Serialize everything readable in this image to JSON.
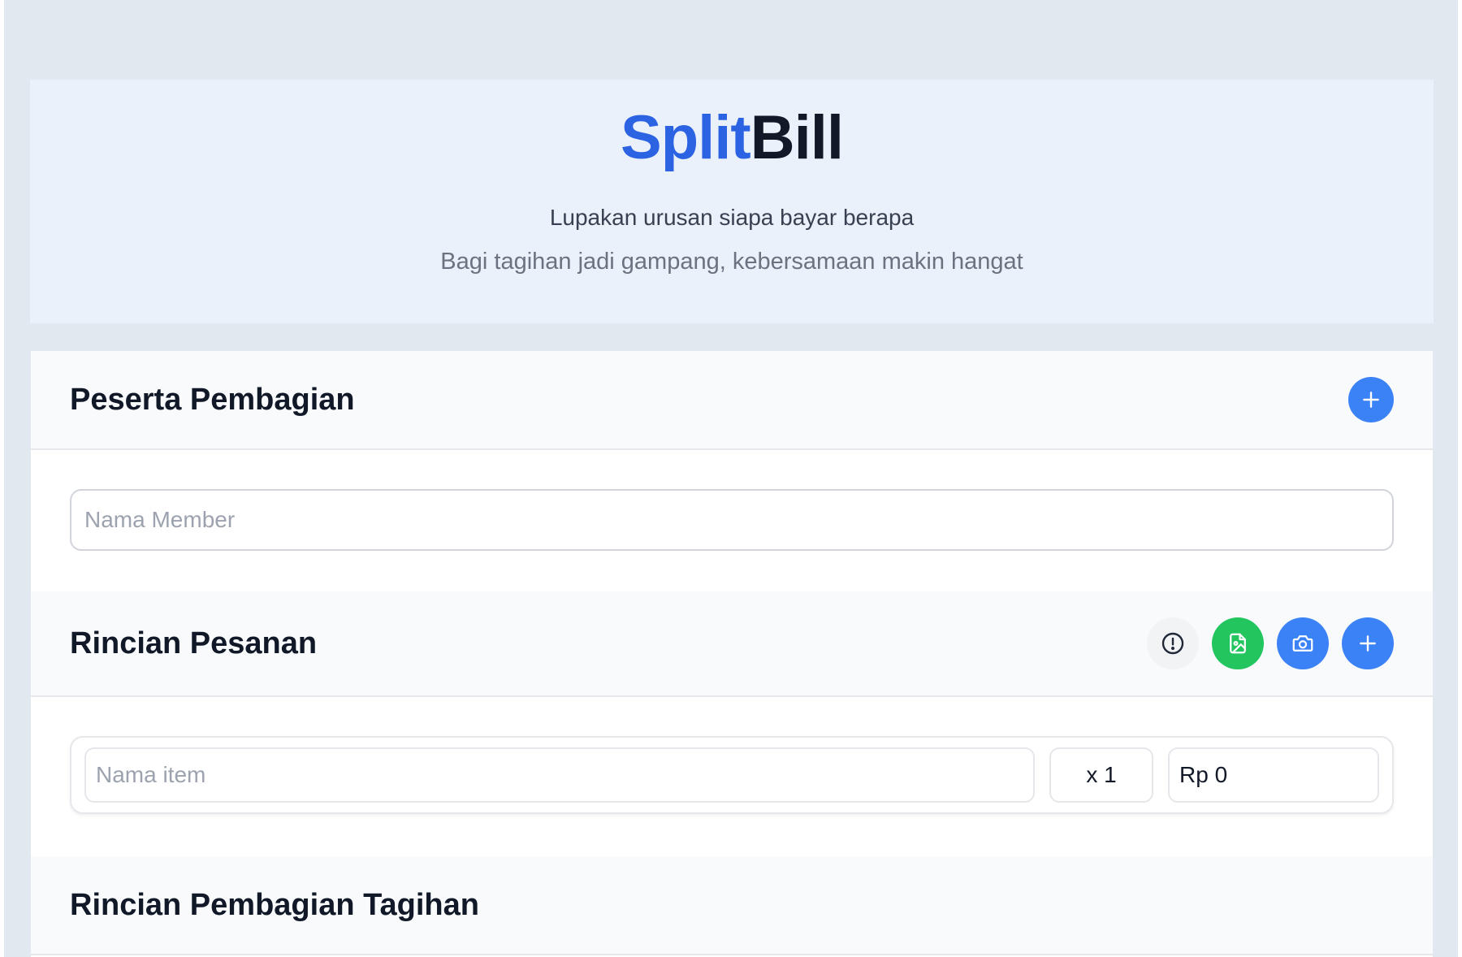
{
  "header": {
    "brand_part1": "Split",
    "brand_part2": "Bill",
    "tagline": "Lupakan urusan siapa bayar berapa",
    "subtagline": "Bagi tagihan jadi gampang, kebersamaan makin hangat"
  },
  "participants": {
    "title": "Peserta Pembagian",
    "add_icon": "plus-icon",
    "member_input": {
      "placeholder": "Nama Member",
      "value": ""
    }
  },
  "orders": {
    "title": "Rincian Pesanan",
    "icons": [
      "alert-circle-icon",
      "file-image-icon",
      "camera-icon",
      "plus-icon"
    ],
    "item": {
      "name_placeholder": "Nama item",
      "name_value": "",
      "qty_value": "x 1",
      "price_value": "Rp 0"
    }
  },
  "breakdown": {
    "title": "Rincian Pembagian Tagihan"
  },
  "colors": {
    "brand_blue": "#2b63e3",
    "button_blue": "#3b82f6",
    "button_green": "#22c55e",
    "page_background": "#e2e8f0"
  }
}
